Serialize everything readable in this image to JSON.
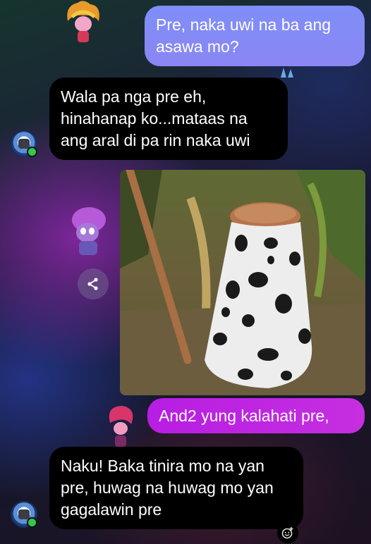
{
  "messages": [
    {
      "direction": "sent",
      "text": "Pre, naka uwi na ba ang asawa mo?"
    },
    {
      "direction": "received",
      "text": "Wala pa nga pre eh, hinahanap ko...mataas na ang aral di pa rin naka uwi"
    },
    {
      "direction": "received",
      "type": "photo"
    },
    {
      "direction": "sent",
      "text": "And2 yung kalahati pre,"
    },
    {
      "direction": "received",
      "text": "Naku! Baka tinira mo na yan pre, huwag na huwag mo yan gagalawin pre"
    }
  ],
  "icons": {
    "share": "share-icon",
    "react": "add-reaction-icon",
    "contact": "contact-avatar",
    "online": "online-status-dot"
  },
  "colors": {
    "sent_bubble": "#8a8df6",
    "sent_bubble_highlight": "#c02ae1",
    "received_bubble": "#000000",
    "online": "#31c94c"
  }
}
